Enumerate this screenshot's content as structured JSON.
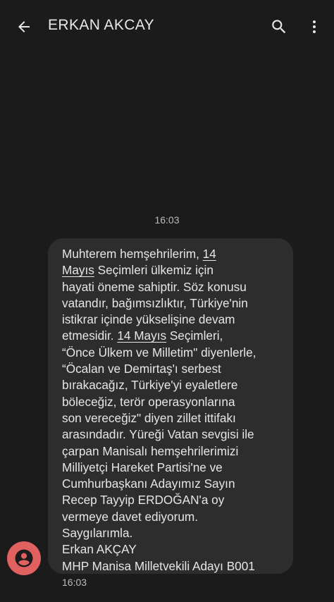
{
  "header": {
    "title": "ERKAN AKCAY",
    "back_icon": "arrow-left-icon",
    "search_icon": "search-icon",
    "more_icon": "more-vert-icon"
  },
  "conversation": {
    "time_divider": "16:03",
    "message": {
      "lines": [
        [
          "Muhterem hemşehrilerim, ",
          {
            "link": "14"
          }
        ],
        [
          {
            "link": "Mayıs"
          },
          " Seçimleri ülkemiz için"
        ],
        [
          "hayati öneme sahiptir. Söz konusu"
        ],
        [
          "vatandır, bağımsızlıktır, Türkiye'nin"
        ],
        [
          "istikrar içinde yükselişine devam"
        ],
        [
          "etmesidir. ",
          {
            "link": "14 Mayıs"
          },
          " Seçimleri,"
        ],
        [
          "“Önce Ülkem ve Milletim\" diyenlerle,"
        ],
        [
          "“Öcalan ve Demirtaş'ı serbest"
        ],
        [
          "bırakacağız, Türkiye'yi eyaletlere"
        ],
        [
          "böleceğiz, terör operasyonlarına"
        ],
        [
          "son vereceğiz\" diyen zillet ittifakı"
        ],
        [
          "arasındadır. Yüreği Vatan sevgisi ile"
        ],
        [
          "çarpan Manisalı hemşehrilerimizi"
        ],
        [
          "Milliyetçi Hareket Partisi'ne ve"
        ],
        [
          "Cumhurbaşkanı Adayımız Sayın"
        ],
        [
          "Recep Tayyip ERDOĞAN'a oy"
        ],
        [
          "vermeye davet ediyorum."
        ],
        [
          "Saygılarımla."
        ],
        [
          "Erkan AKÇAY"
        ],
        [
          "MHP Manisa Milletvekili Adayı B001"
        ]
      ],
      "timestamp": "16:03"
    },
    "sender_avatar_icon": "person-icon",
    "colors": {
      "background": "#1b1b1b",
      "bubble": "#2d2d2d",
      "avatar": "#e16161"
    }
  }
}
